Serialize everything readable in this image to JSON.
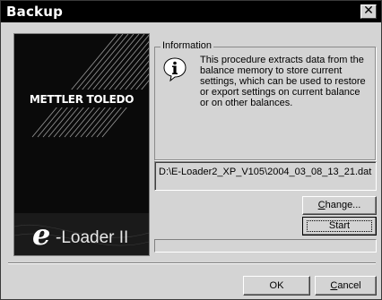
{
  "window": {
    "title": "Backup",
    "close_glyph": "✕"
  },
  "brand": {
    "logo_text": "METTLER TOLEDO",
    "product_e": "e",
    "product_name": "-Loader II"
  },
  "information": {
    "legend": "Information",
    "icon": "information-icon",
    "text": "This procedure extracts data from the balance memory to store current settings, which can be used to restore or export settings on current balance or on other balances."
  },
  "file_path": {
    "value": "D:\\E-Loader2_XP_V105\\2004_03_08_13_21.dat"
  },
  "buttons": {
    "change_prefix": "",
    "change_mnemonic": "C",
    "change_rest": "hange...",
    "start_label": "Start",
    "ok_label": "OK",
    "cancel_mnemonic": "C",
    "cancel_rest": "ancel"
  },
  "progress": {
    "fraction": 0
  },
  "colors": {
    "face": "#d4d4d4",
    "titlebar": "#000000",
    "brand_panel": "#0a0a0a"
  }
}
